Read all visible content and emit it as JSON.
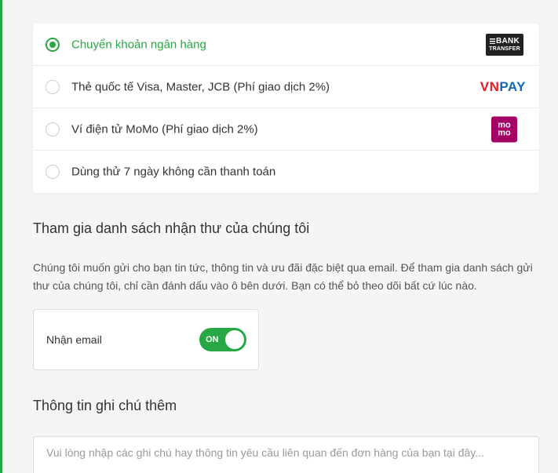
{
  "payment_methods": [
    {
      "label": "Chuyển khoản ngân hàng",
      "selected": true,
      "logo": "bank-transfer-logo"
    },
    {
      "label": "Thẻ quốc tế Visa, Master, JCB (Phí giao dịch 2%)",
      "selected": false,
      "logo": "vnpay-logo"
    },
    {
      "label": "Ví điện tử MoMo (Phí giao dịch 2%)",
      "selected": false,
      "logo": "momo-logo"
    },
    {
      "label": "Dùng thử 7 ngày không cần thanh toán",
      "selected": false,
      "logo": ""
    }
  ],
  "logos": {
    "bank_line1": "BANK",
    "bank_line2": "TRANSFER",
    "vnpay_vn": "VN",
    "vnpay_pay": "PAY",
    "momo_top": "mo",
    "momo_bottom": "mo"
  },
  "newsletter": {
    "title": "Tham gia danh sách nhận thư của chúng tôi",
    "description": "Chúng tôi muốn gửi cho bạn tin tức, thông tin và ưu đãi đặc biệt qua email. Để tham gia danh sách gửi thư của chúng tôi, chỉ cần đánh dấu vào ô bên dưới. Bạn có thể bỏ theo dõi bất cứ lúc nào.",
    "toggle_label": "Nhận email",
    "toggle_state": "ON"
  },
  "notes": {
    "title": "Thông tin ghi chú thêm",
    "placeholder": "Vui lòng nhập các ghi chú hay thông tin yêu cầu liên quan đến đơn hàng của bạn tại đây..."
  },
  "colors": {
    "accent": "#27a844",
    "vnpay_red": "#e31e25",
    "vnpay_blue": "#1467b3",
    "momo": "#a50064"
  }
}
